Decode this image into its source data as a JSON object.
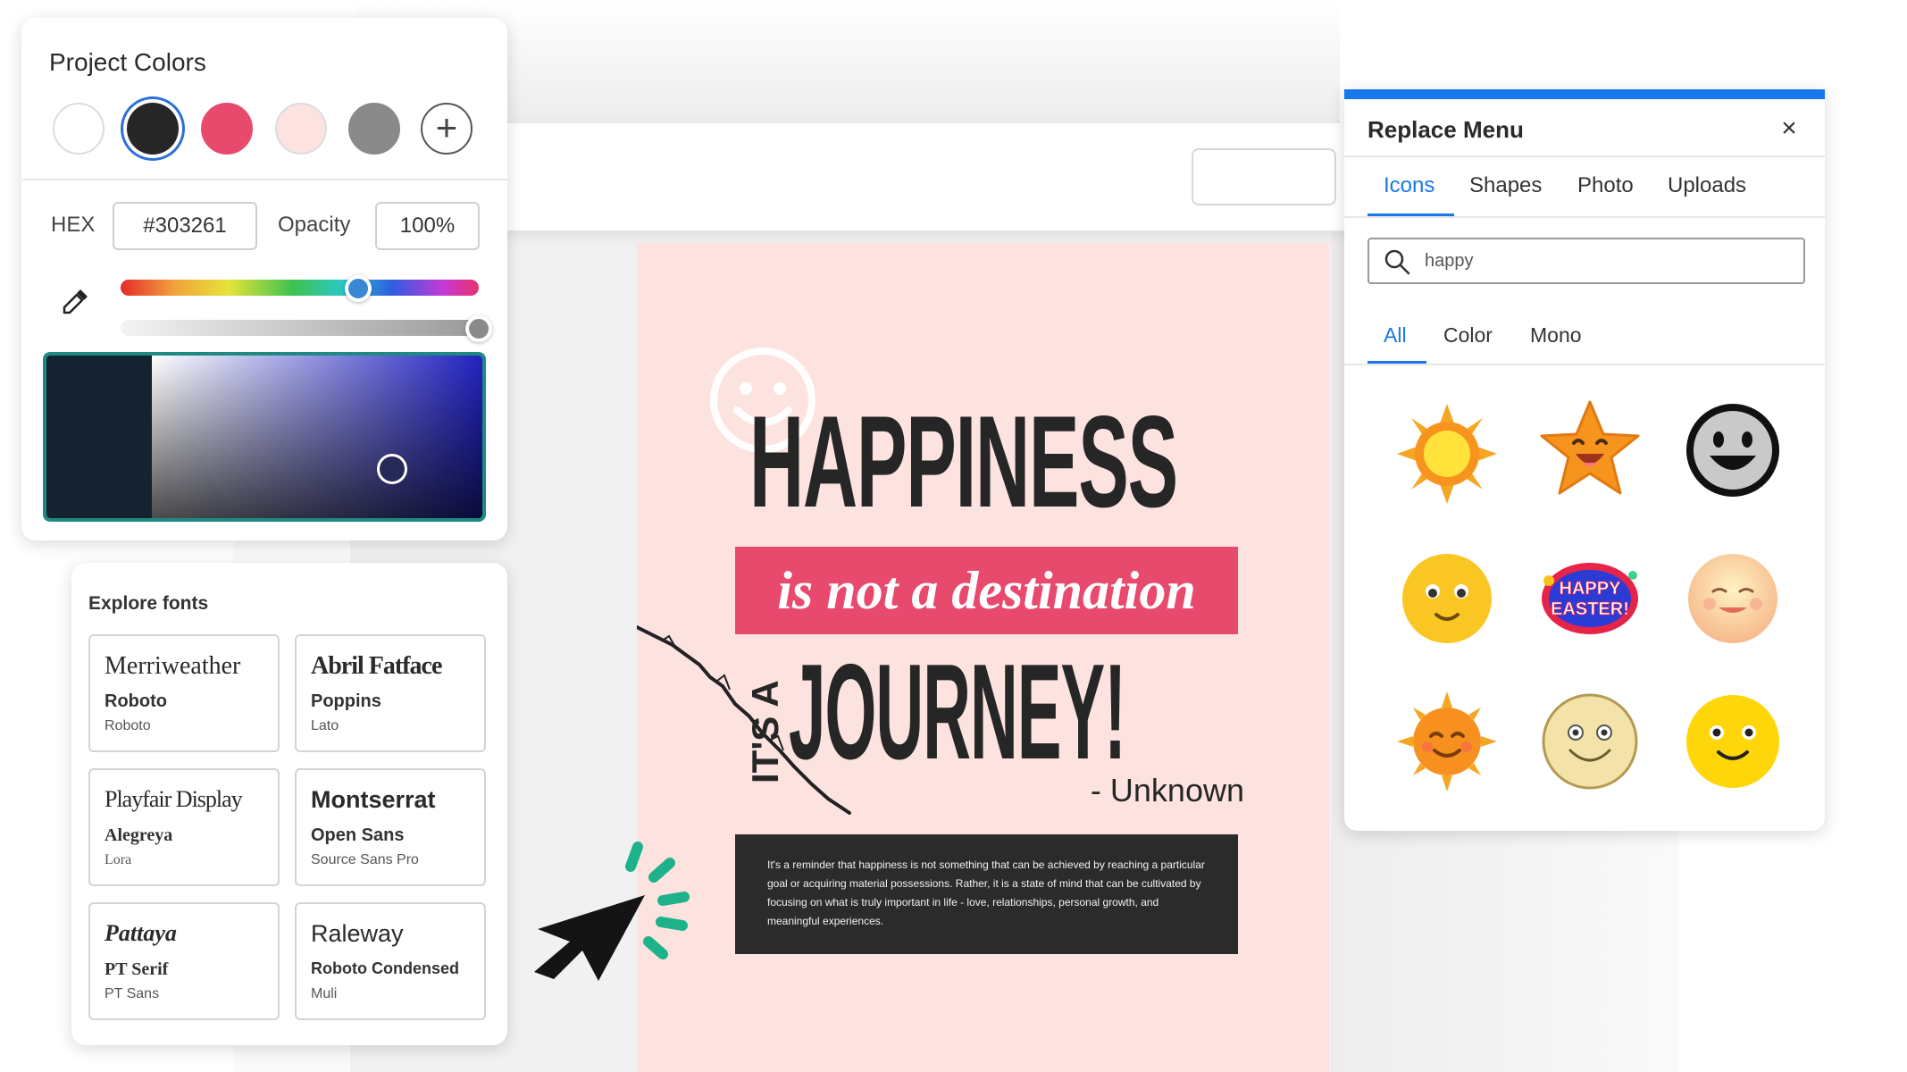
{
  "project_colors": {
    "title": "Project Colors",
    "swatches": [
      "#ffffff",
      "#262626",
      "#e84a6e",
      "#fde3df",
      "#8a8a8a"
    ],
    "selected_swatch": 1,
    "hex_label": "HEX",
    "hex_value": "#303261",
    "opacity_label": "Opacity",
    "opacity_value": "100%",
    "add_icon": "plus-icon",
    "eyedropper_icon": "eyedropper-icon"
  },
  "explore_fonts": {
    "title": "Explore fonts",
    "cards": [
      {
        "heading": "Merriweather",
        "sub": "Roboto",
        "small": "Roboto"
      },
      {
        "heading": "Abril Fatface",
        "sub": "Poppins",
        "small": "Lato"
      },
      {
        "heading": "Playfair Display",
        "sub": "Alegreya",
        "small": "Lora"
      },
      {
        "heading": "Montserrat",
        "sub": "Open Sans",
        "small": "Source Sans Pro"
      },
      {
        "heading": "Pattaya",
        "sub": "PT Serif",
        "small": "PT Sans"
      },
      {
        "heading": "Raleway",
        "sub": "Roboto Condensed",
        "small": "Muli"
      }
    ]
  },
  "poster": {
    "headline": "HAPPINESS",
    "banner": "is not a destination",
    "its_a": "IT'S A",
    "journey": "JOURNEY!",
    "attribution": "- Unknown",
    "quote": "It's a reminder that happiness is not something that can be achieved by reaching a particular goal or acquiring material possessions. Rather, it is a state of mind that can be cultivated by focusing on what is truly important in life - love, relationships, personal growth, and meaningful experiences.",
    "colors": {
      "background": "#fde3df",
      "accent": "#e84a6e",
      "dark": "#262626"
    }
  },
  "replace_menu": {
    "title": "Replace Menu",
    "close_icon": "close-icon",
    "tabs": [
      "Icons",
      "Shapes",
      "Photo",
      "Uploads"
    ],
    "active_tab": "Icons",
    "search_placeholder": "happy",
    "subtabs": [
      "All",
      "Color",
      "Mono"
    ],
    "active_subtab": "All",
    "icons": [
      "sun-icon",
      "smiling-star-icon",
      "black-smiley-icon",
      "yellow-smiley-icon",
      "happy-easter-sticker-icon",
      "peach-smiley-icon",
      "smiling-sun-icon",
      "pale-smiley-icon",
      "yellow-smiley-face-icon"
    ],
    "sticker_text": [
      "HAPPY",
      "EASTER!"
    ],
    "accent": "#1877e9"
  }
}
